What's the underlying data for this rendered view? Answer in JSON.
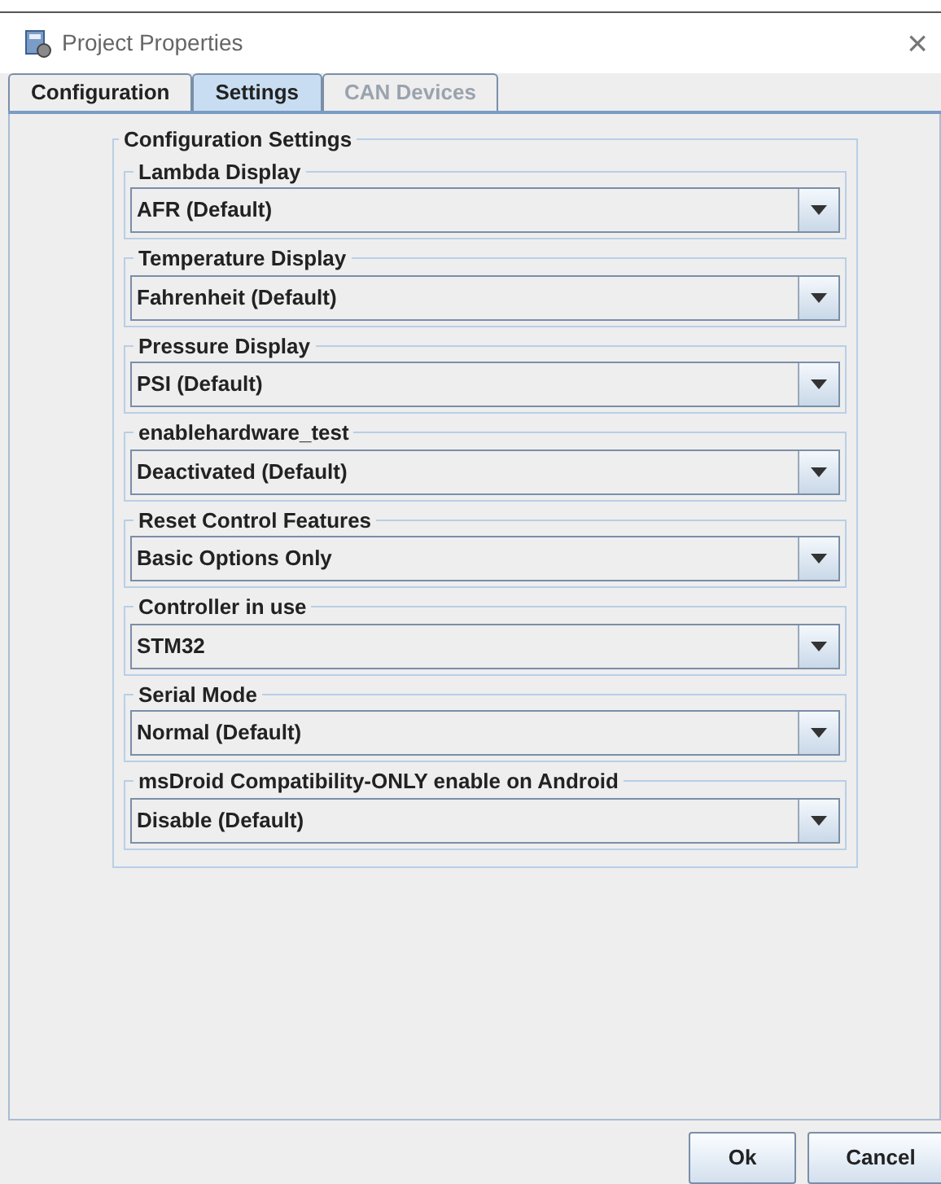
{
  "window": {
    "title": "Project Properties",
    "close": "×"
  },
  "tabs": [
    {
      "label": "Configuration",
      "selected": false,
      "disabled": false
    },
    {
      "label": "Settings",
      "selected": true,
      "disabled": false
    },
    {
      "label": "CAN Devices",
      "selected": false,
      "disabled": true
    }
  ],
  "group": {
    "title": "Configuration Settings",
    "settings": [
      {
        "label": "Lambda Display",
        "value": "AFR (Default)"
      },
      {
        "label": "Temperature Display",
        "value": "Fahrenheit (Default)"
      },
      {
        "label": "Pressure Display",
        "value": "PSI (Default)"
      },
      {
        "label": "enablehardware_test",
        "value": "Deactivated (Default)"
      },
      {
        "label": "Reset Control Features",
        "value": "Basic Options Only"
      },
      {
        "label": "Controller in use",
        "value": "STM32"
      },
      {
        "label": "Serial Mode",
        "value": "Normal (Default)"
      },
      {
        "label": "msDroid Compatibility-ONLY enable on Android",
        "value": "Disable (Default)"
      }
    ]
  },
  "buttons": [
    "Ok",
    "Cancel"
  ]
}
